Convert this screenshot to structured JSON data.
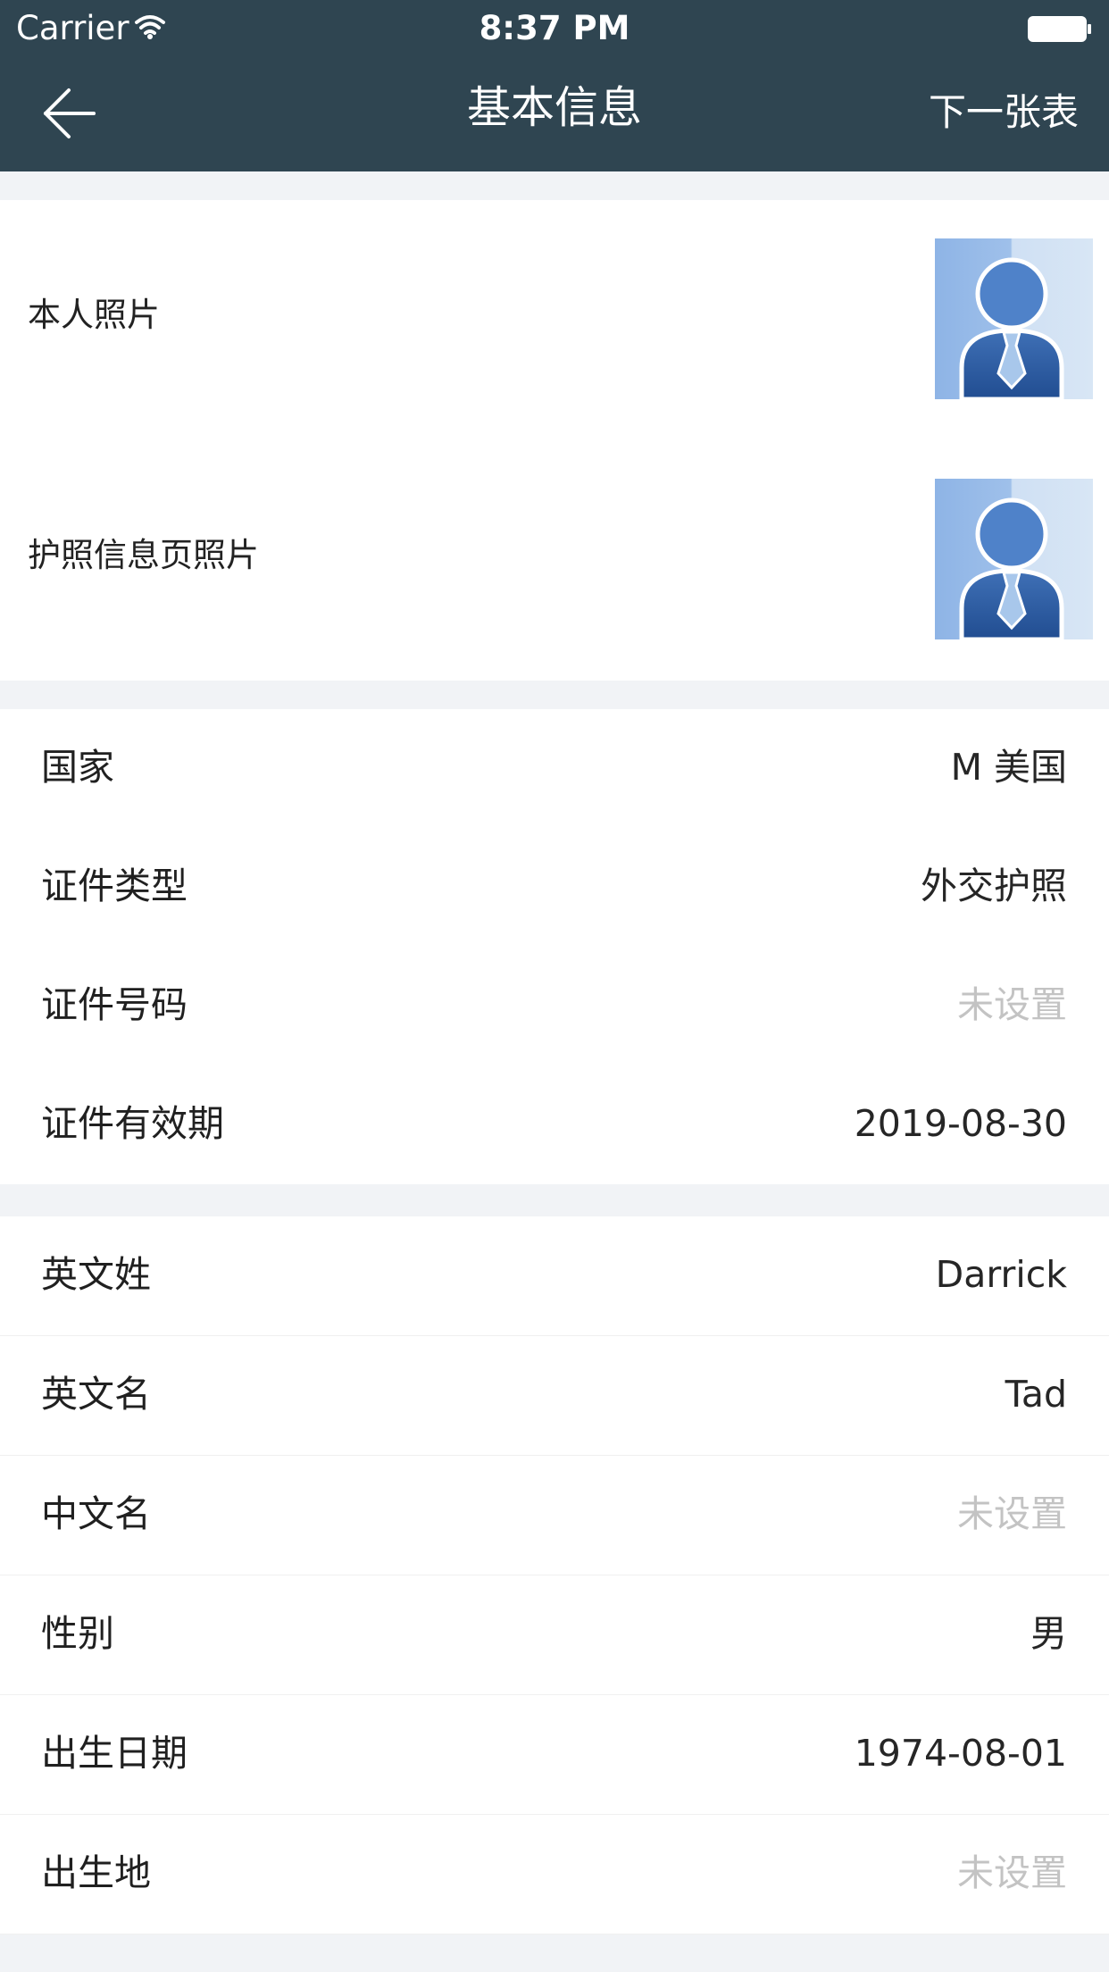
{
  "status_bar": {
    "carrier": "Carrier",
    "time": "8:37 PM",
    "icons": [
      "wifi-icon",
      "battery-icon"
    ]
  },
  "header": {
    "title": "基本信息",
    "back_icon": "arrow-left-icon",
    "next_label": "下一张表",
    "bg_color": "#2f4551"
  },
  "photos": {
    "items": [
      {
        "label": "本人照片",
        "icon": "avatar-icon"
      },
      {
        "label": "护照信息页照片",
        "icon": "avatar-icon"
      }
    ]
  },
  "document": {
    "fields": [
      {
        "label": "国家",
        "value": "M 美国"
      },
      {
        "label": "证件类型",
        "value": "外交护照"
      },
      {
        "label": "证件号码",
        "value": "未设置"
      },
      {
        "label": "证件有效期",
        "value": "2019-08-30"
      }
    ]
  },
  "personal": {
    "fields": [
      {
        "label": "英文姓",
        "value": "Darrick"
      },
      {
        "label": "英文名",
        "value": "Tad"
      },
      {
        "label": "中文名",
        "value": "未设置"
      },
      {
        "label": "性别",
        "value": "男"
      },
      {
        "label": "出生日期",
        "value": "1974-08-01"
      },
      {
        "label": "出生地",
        "value": "未设置"
      }
    ]
  },
  "colors": {
    "placeholder": "#c3c3c3",
    "section_gap": "#f1f3f6"
  }
}
